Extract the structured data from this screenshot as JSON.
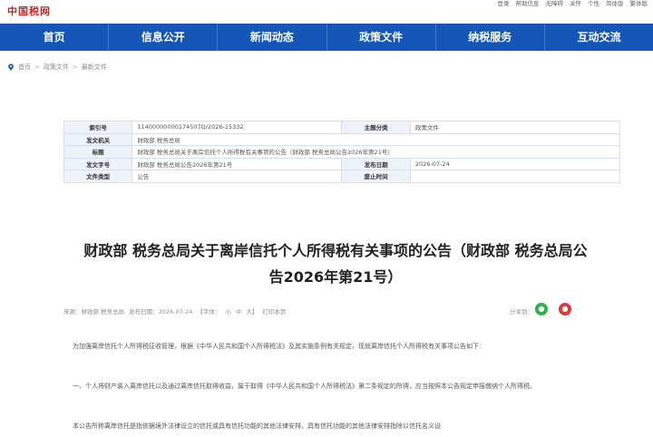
{
  "header": {
    "logo_text": "中国税网",
    "links": [
      "登录",
      "帮助信息",
      "无障碍",
      "关怀",
      "个性",
      "简体版",
      "繁体版"
    ]
  },
  "nav": [
    "首页",
    "信息公开",
    "新闻动态",
    "政策文件",
    "纳税服务",
    "互动交流"
  ],
  "breadcrumb": [
    "首页",
    "政策文件",
    "最新文件"
  ],
  "meta": {
    "rows": [
      [
        "索引号",
        "11400000000174507Q/2026-15332",
        "主题分类",
        "政策文件"
      ],
      [
        "发文机关",
        "财政部 税务总局",
        "",
        ""
      ],
      [
        "标题",
        "财政部 税务总局关于离岸信托个人所得税有关事项的公告（财政部 税务总局公告2026年第21号）",
        "",
        ""
      ],
      [
        "发文字号",
        "财政部 税务总局公告2026年第21号",
        "发布日期",
        "2026-07-24"
      ],
      [
        "文件类型",
        "公告",
        "废止时间",
        ""
      ]
    ]
  },
  "article": {
    "title_line1": "财政部 税务总局关于离岸信托个人所得税有关事项的公告（财政部 税务总局公",
    "title_line2": "告2026年第21号）",
    "source": "来源：财政部 税务总局",
    "date": "发布日期：2026-07-24",
    "font_size_label": "【字体：",
    "size_small": "小",
    "size_medium": "中",
    "size_large": "大】",
    "print": "打印本页",
    "share_label": "分享到：",
    "p1": "为加强离岸信托个人所得税征收管理，根据《中华人民共和国个人所得税法》及其实施条例有关规定，现就离岸信托个人所得税有关事项公告如下：",
    "p2": "一、个人将财产装入离岸信托以及通过离岸信托取得收益，属于取得《中华人民共和国个人所得税法》第二条规定的所得，应当按照本公告规定申报缴纳个人所得税。",
    "p3": "本公告所称离岸信托是指依据境外法律设立的信托或具有信托功能的其他法律安排，具有信托功能的其他法律安排指除以信托名义设"
  }
}
